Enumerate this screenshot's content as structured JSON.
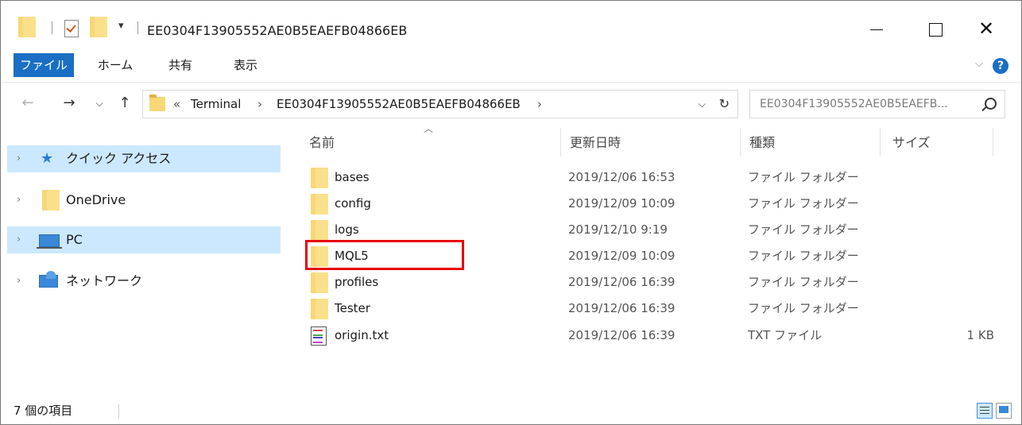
{
  "window": {
    "title": "EE0304F13905552AE0B5EAEFB04866EB"
  },
  "ribbon": {
    "tabs": [
      {
        "label": "ファイル"
      },
      {
        "label": "ホーム"
      },
      {
        "label": "共有"
      },
      {
        "label": "表示"
      }
    ]
  },
  "address": {
    "prefix": "«",
    "crumbs": [
      "Terminal",
      "EE0304F13905552AE0B5EAEFB04866EB"
    ],
    "separator": "›"
  },
  "search": {
    "placeholder": "EE0304F13905552AE0B5EAEFB..."
  },
  "nav": {
    "items": [
      {
        "label": "クイック アクセス",
        "icon": "star-icon"
      },
      {
        "label": "OneDrive",
        "icon": "folder-icon"
      },
      {
        "label": "PC",
        "icon": "pc-icon"
      },
      {
        "label": "ネットワーク",
        "icon": "network-icon"
      }
    ]
  },
  "columns": {
    "name": "名前",
    "modified": "更新日時",
    "type": "種類",
    "size": "サイズ"
  },
  "files": [
    {
      "name": "bases",
      "modified": "2019/12/06 16:53",
      "type": "ファイル フォルダー",
      "size": "",
      "icon": "folder-icon"
    },
    {
      "name": "config",
      "modified": "2019/12/09 10:09",
      "type": "ファイル フォルダー",
      "size": "",
      "icon": "folder-icon"
    },
    {
      "name": "logs",
      "modified": "2019/12/10 9:19",
      "type": "ファイル フォルダー",
      "size": "",
      "icon": "folder-icon"
    },
    {
      "name": "MQL5",
      "modified": "2019/12/09 10:09",
      "type": "ファイル フォルダー",
      "size": "",
      "icon": "folder-icon"
    },
    {
      "name": "profiles",
      "modified": "2019/12/06 16:39",
      "type": "ファイル フォルダー",
      "size": "",
      "icon": "folder-icon"
    },
    {
      "name": "Tester",
      "modified": "2019/12/06 16:39",
      "type": "ファイル フォルダー",
      "size": "",
      "icon": "folder-icon"
    },
    {
      "name": "origin.txt",
      "modified": "2019/12/06 16:39",
      "type": "TXT ファイル",
      "size": "1 KB",
      "icon": "text-file-icon"
    }
  ],
  "status": {
    "item_count": "7 個の項目"
  },
  "colors": {
    "accent": "#1a6fc4",
    "selection": "#cce8ff",
    "highlight_box": "#e60000",
    "folder": "#f8d775"
  }
}
